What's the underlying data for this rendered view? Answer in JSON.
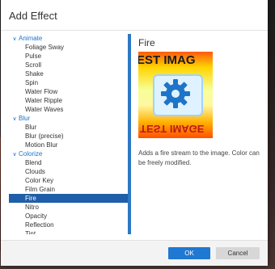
{
  "dialog": {
    "title": "Add Effect"
  },
  "tree": {
    "rows": [
      {
        "kind": "group",
        "label": "Animate",
        "chevron": "chevron-down-icon"
      },
      {
        "kind": "item",
        "label": "Foliage Sway"
      },
      {
        "kind": "item",
        "label": "Pulse"
      },
      {
        "kind": "item",
        "label": "Scroll"
      },
      {
        "kind": "item",
        "label": "Shake"
      },
      {
        "kind": "item",
        "label": "Spin"
      },
      {
        "kind": "item",
        "label": "Water Flow"
      },
      {
        "kind": "item",
        "label": "Water Ripple"
      },
      {
        "kind": "item",
        "label": "Water Waves"
      },
      {
        "kind": "group",
        "label": "Blur",
        "chevron": "chevron-down-icon"
      },
      {
        "kind": "item",
        "label": "Blur"
      },
      {
        "kind": "item",
        "label": "Blur (precise)"
      },
      {
        "kind": "item",
        "label": "Motion Blur"
      },
      {
        "kind": "group",
        "label": "Colorize",
        "chevron": "chevron-down-icon"
      },
      {
        "kind": "item",
        "label": "Blend"
      },
      {
        "kind": "item",
        "label": "Clouds"
      },
      {
        "kind": "item",
        "label": "Color Key"
      },
      {
        "kind": "item",
        "label": "Film Grain"
      },
      {
        "kind": "item",
        "label": "Fire",
        "selected": true
      },
      {
        "kind": "item",
        "label": "Nitro"
      },
      {
        "kind": "item",
        "label": "Opacity"
      },
      {
        "kind": "item",
        "label": "Reflection"
      },
      {
        "kind": "item",
        "label": "Tint"
      }
    ]
  },
  "detail": {
    "title": "Fire",
    "preview": {
      "top_text": "EST IMAG",
      "bottom_text": "TEST IMAGE",
      "icon": "gear-icon"
    },
    "description": "Adds a fire stream to the image. Color can be freely modified."
  },
  "footer": {
    "ok_label": "OK",
    "cancel_label": "Cancel"
  },
  "colors": {
    "accent": "#1f78d1",
    "selection": "#1f5ea8",
    "group_text": "#1a73c8"
  }
}
